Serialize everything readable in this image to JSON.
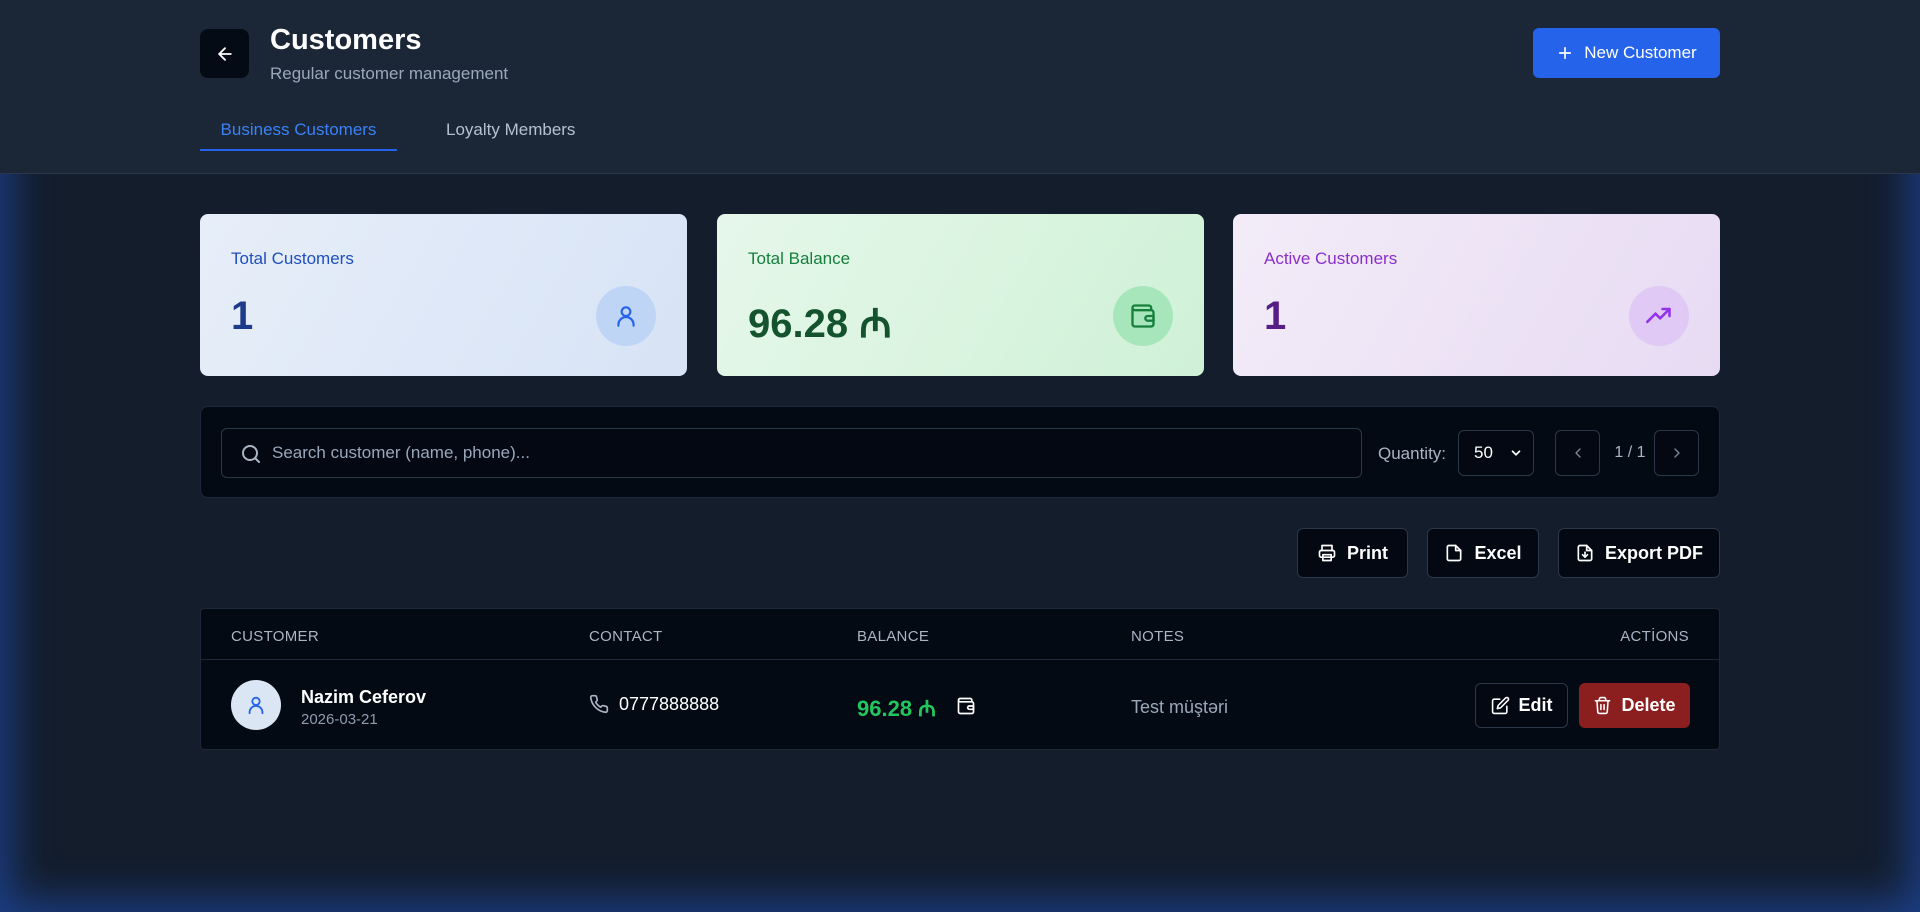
{
  "header": {
    "title": "Customers",
    "subtitle": "Regular customer management",
    "new_button": "New Customer",
    "tabs": [
      {
        "label": "Business Customers",
        "active": true
      },
      {
        "label": "Loyalty Members",
        "active": false
      }
    ]
  },
  "stats": [
    {
      "label": "Total Customers",
      "value": "1",
      "icon": "user-icon"
    },
    {
      "label": "Total Balance",
      "value": "96.28 ₼",
      "icon": "wallet-icon"
    },
    {
      "label": "Active Customers",
      "value": "1",
      "icon": "trending-up-icon"
    }
  ],
  "filters": {
    "search_placeholder": "Search customer (name, phone)...",
    "search_value": "",
    "quantity_label": "Quantity:",
    "quantity_value": "50",
    "page_info": "1 / 1"
  },
  "actions": {
    "print": "Print",
    "excel": "Excel",
    "export_pdf": "Export PDF"
  },
  "table": {
    "columns": [
      "CUSTOMER",
      "CONTACT",
      "BALANCE",
      "NOTES",
      "ACTİONS"
    ],
    "rows": [
      {
        "name": "Nazim Ceferov",
        "date": "2026-03-21",
        "phone": "0777888888",
        "balance": "96.28 ₼",
        "notes": "Test müştəri",
        "edit": "Edit",
        "delete": "Delete"
      }
    ]
  },
  "colors": {
    "accent": "#2563eb",
    "background": "#131d2c",
    "success": "#22c55e",
    "danger": "#8b1e1e"
  }
}
